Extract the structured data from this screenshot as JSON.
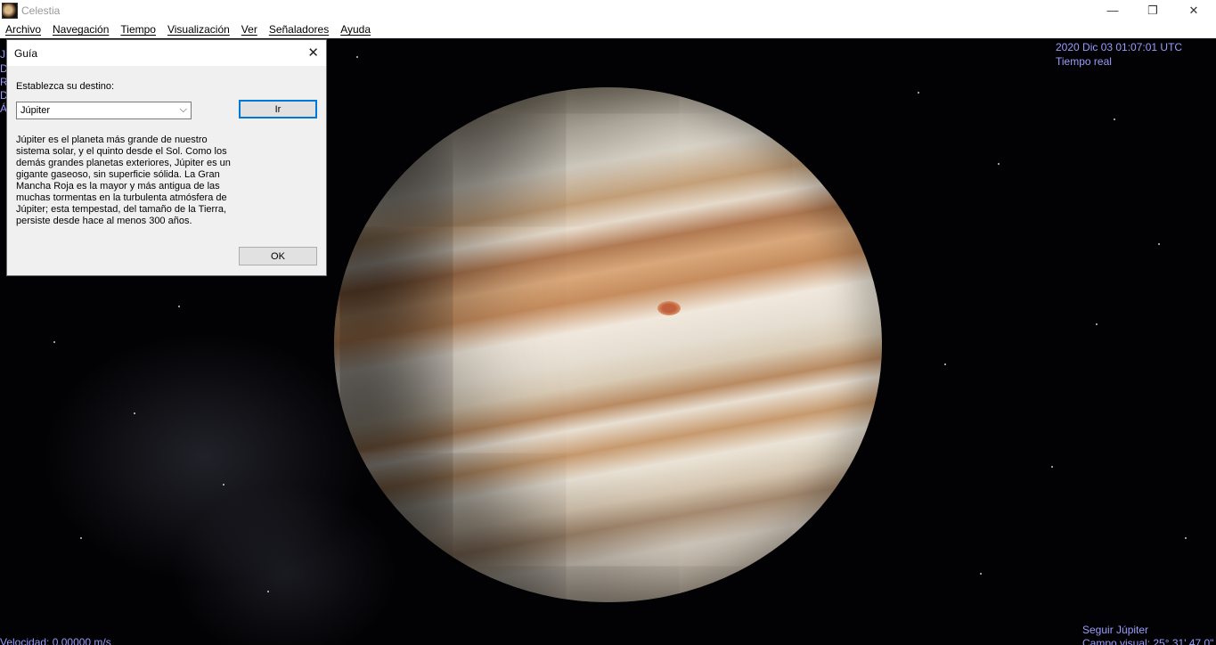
{
  "window": {
    "title": "Celestia",
    "icon": "celestia-app-icon",
    "minimize_glyph": "—",
    "restore_glyph": "❐",
    "close_glyph": "✕"
  },
  "menu": [
    "Archivo",
    "Navegación",
    "Tiempo",
    "Visualización",
    "Ver",
    "Señaladores",
    "Ayuda"
  ],
  "hud": {
    "datetime": "2020 Dic 03 01:07:01 UTC",
    "time_mode": "Tiempo real",
    "left_clipped": [
      "J",
      "D",
      "R",
      "D",
      "Á"
    ],
    "speed": "Velocidad: 0.00000 m/s",
    "follow": "Seguir Júpiter",
    "fov": "Campo visual: 25° 31' 47.0\"",
    "text_color": "#9a9cff"
  },
  "dialog": {
    "title": "Guía",
    "close_glyph": "✕",
    "destination_label": "Establezca su destino:",
    "destination_value": "Júpiter",
    "chevron": "⌵",
    "go_label": "Ir",
    "description": "Júpiter es el planeta más grande de nuestro\nsistema solar, y el quinto desde el Sol.  Como los\ndemás grandes planetas exteriores, Júpiter es un\ngigante gaseoso, sin superficie sólida. La Gran\nMancha Roja es la mayor y más antigua de las\nmuchas tormentas en la turbulenta atmósfera de\nJúpiter; esta tempestad, del tamaño de la Tierra,\npersiste desde hace al menos 300 años.",
    "ok_label": "OK"
  }
}
